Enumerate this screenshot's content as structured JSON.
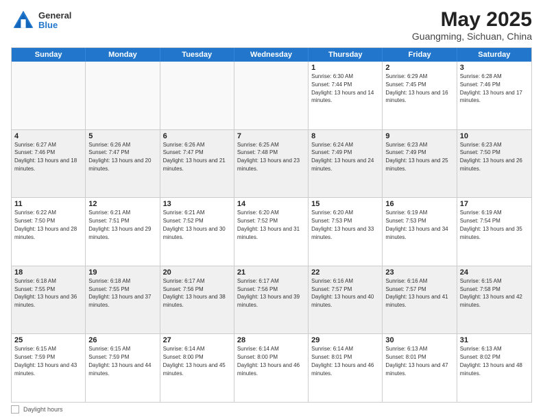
{
  "header": {
    "logo_general": "General",
    "logo_blue": "Blue",
    "title": "May 2025",
    "subtitle": "Guangming, Sichuan, China"
  },
  "days_of_week": [
    "Sunday",
    "Monday",
    "Tuesday",
    "Wednesday",
    "Thursday",
    "Friday",
    "Saturday"
  ],
  "weeks": [
    [
      {
        "day": "",
        "empty": true
      },
      {
        "day": "",
        "empty": true
      },
      {
        "day": "",
        "empty": true
      },
      {
        "day": "",
        "empty": true
      },
      {
        "day": "1",
        "sunrise": "6:30 AM",
        "sunset": "7:44 PM",
        "daylight": "13 hours and 14 minutes."
      },
      {
        "day": "2",
        "sunrise": "6:29 AM",
        "sunset": "7:45 PM",
        "daylight": "13 hours and 16 minutes."
      },
      {
        "day": "3",
        "sunrise": "6:28 AM",
        "sunset": "7:46 PM",
        "daylight": "13 hours and 17 minutes."
      }
    ],
    [
      {
        "day": "4",
        "sunrise": "6:27 AM",
        "sunset": "7:46 PM",
        "daylight": "13 hours and 18 minutes."
      },
      {
        "day": "5",
        "sunrise": "6:26 AM",
        "sunset": "7:47 PM",
        "daylight": "13 hours and 20 minutes."
      },
      {
        "day": "6",
        "sunrise": "6:26 AM",
        "sunset": "7:47 PM",
        "daylight": "13 hours and 21 minutes."
      },
      {
        "day": "7",
        "sunrise": "6:25 AM",
        "sunset": "7:48 PM",
        "daylight": "13 hours and 23 minutes."
      },
      {
        "day": "8",
        "sunrise": "6:24 AM",
        "sunset": "7:49 PM",
        "daylight": "13 hours and 24 minutes."
      },
      {
        "day": "9",
        "sunrise": "6:23 AM",
        "sunset": "7:49 PM",
        "daylight": "13 hours and 25 minutes."
      },
      {
        "day": "10",
        "sunrise": "6:23 AM",
        "sunset": "7:50 PM",
        "daylight": "13 hours and 26 minutes."
      }
    ],
    [
      {
        "day": "11",
        "sunrise": "6:22 AM",
        "sunset": "7:50 PM",
        "daylight": "13 hours and 28 minutes."
      },
      {
        "day": "12",
        "sunrise": "6:21 AM",
        "sunset": "7:51 PM",
        "daylight": "13 hours and 29 minutes."
      },
      {
        "day": "13",
        "sunrise": "6:21 AM",
        "sunset": "7:52 PM",
        "daylight": "13 hours and 30 minutes."
      },
      {
        "day": "14",
        "sunrise": "6:20 AM",
        "sunset": "7:52 PM",
        "daylight": "13 hours and 31 minutes."
      },
      {
        "day": "15",
        "sunrise": "6:20 AM",
        "sunset": "7:53 PM",
        "daylight": "13 hours and 33 minutes."
      },
      {
        "day": "16",
        "sunrise": "6:19 AM",
        "sunset": "7:53 PM",
        "daylight": "13 hours and 34 minutes."
      },
      {
        "day": "17",
        "sunrise": "6:19 AM",
        "sunset": "7:54 PM",
        "daylight": "13 hours and 35 minutes."
      }
    ],
    [
      {
        "day": "18",
        "sunrise": "6:18 AM",
        "sunset": "7:55 PM",
        "daylight": "13 hours and 36 minutes."
      },
      {
        "day": "19",
        "sunrise": "6:18 AM",
        "sunset": "7:55 PM",
        "daylight": "13 hours and 37 minutes."
      },
      {
        "day": "20",
        "sunrise": "6:17 AM",
        "sunset": "7:56 PM",
        "daylight": "13 hours and 38 minutes."
      },
      {
        "day": "21",
        "sunrise": "6:17 AM",
        "sunset": "7:56 PM",
        "daylight": "13 hours and 39 minutes."
      },
      {
        "day": "22",
        "sunrise": "6:16 AM",
        "sunset": "7:57 PM",
        "daylight": "13 hours and 40 minutes."
      },
      {
        "day": "23",
        "sunrise": "6:16 AM",
        "sunset": "7:57 PM",
        "daylight": "13 hours and 41 minutes."
      },
      {
        "day": "24",
        "sunrise": "6:15 AM",
        "sunset": "7:58 PM",
        "daylight": "13 hours and 42 minutes."
      }
    ],
    [
      {
        "day": "25",
        "sunrise": "6:15 AM",
        "sunset": "7:59 PM",
        "daylight": "13 hours and 43 minutes."
      },
      {
        "day": "26",
        "sunrise": "6:15 AM",
        "sunset": "7:59 PM",
        "daylight": "13 hours and 44 minutes."
      },
      {
        "day": "27",
        "sunrise": "6:14 AM",
        "sunset": "8:00 PM",
        "daylight": "13 hours and 45 minutes."
      },
      {
        "day": "28",
        "sunrise": "6:14 AM",
        "sunset": "8:00 PM",
        "daylight": "13 hours and 46 minutes."
      },
      {
        "day": "29",
        "sunrise": "6:14 AM",
        "sunset": "8:01 PM",
        "daylight": "13 hours and 46 minutes."
      },
      {
        "day": "30",
        "sunrise": "6:13 AM",
        "sunset": "8:01 PM",
        "daylight": "13 hours and 47 minutes."
      },
      {
        "day": "31",
        "sunrise": "6:13 AM",
        "sunset": "8:02 PM",
        "daylight": "13 hours and 48 minutes."
      }
    ]
  ],
  "footer": {
    "legend_label": "Daylight hours"
  }
}
